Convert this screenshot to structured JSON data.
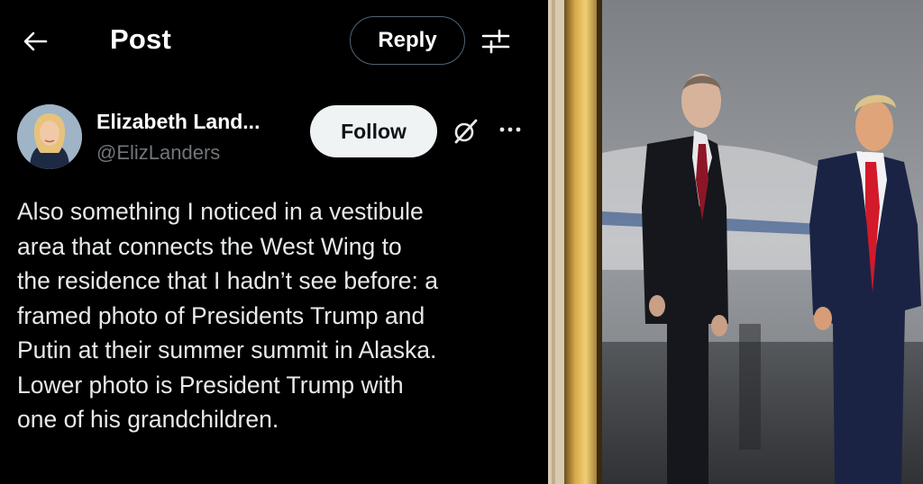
{
  "header": {
    "back_icon": "arrow-left-icon",
    "title": "Post",
    "reply_label": "Reply",
    "adjust_icon": "sliders-icon"
  },
  "author": {
    "name": "Elizabeth Land...",
    "handle": "@ElizLanders",
    "follow_label": "Follow",
    "grok_icon": "grok-icon",
    "more_icon": "more-dots-icon"
  },
  "post": {
    "lines": [
      "Also something I noticed in a vestibule",
      "area that connects the West Wing to",
      "the residence that I hadn’t see before: a",
      "framed photo of Presidents Trump and",
      "Putin at their summer summit in Alaska.",
      "Lower photo is President Trump with",
      "one of his grandchildren."
    ]
  },
  "photo": {
    "description_icon": "framed-photo-image"
  },
  "colors": {
    "background": "#000000",
    "secondary_text": "#71767b",
    "follow_bg": "#eff3f4",
    "tie_red": "#c8102e"
  }
}
